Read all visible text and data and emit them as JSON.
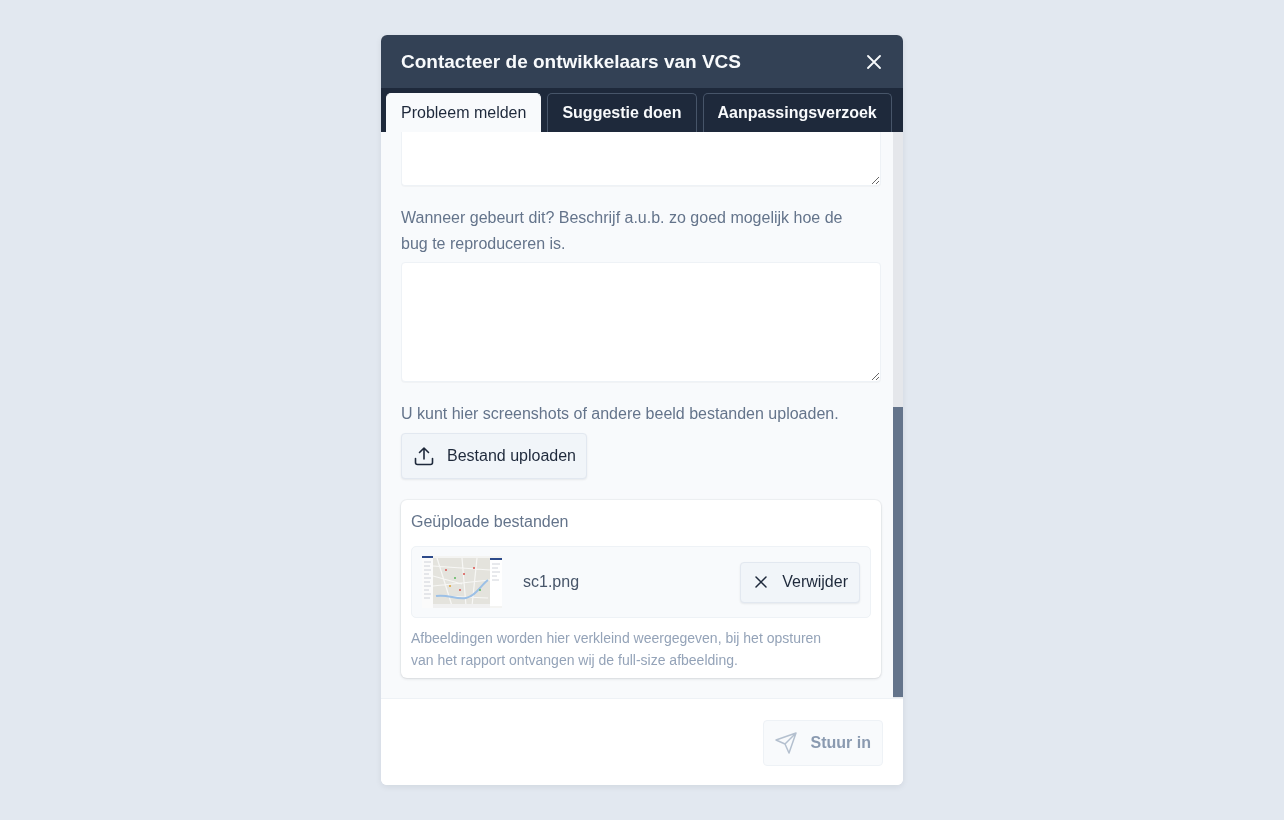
{
  "dialog": {
    "title": "Contacteer de ontwikkelaars van VCS"
  },
  "tabs": [
    {
      "label": "Probleem melden",
      "selected": true
    },
    {
      "label": "Suggestie doen",
      "selected": false
    },
    {
      "label": "Aanpassingsverzoek",
      "selected": false
    }
  ],
  "form": {
    "reproduce_label": "Wanneer gebeurt dit? Beschrijf a.u.b. zo goed mogelijk hoe de bug te reproduceren is.",
    "upload_hint": "U kunt hier screenshots of andere beeld bestanden uploaden.",
    "upload_button": "Bestand uploaden"
  },
  "uploaded_files": {
    "title": "Geüploade bestanden",
    "files": [
      {
        "name": "sc1.png",
        "remove_button": "Verwijder"
      }
    ],
    "note": "Afbeeldingen worden hier verkleind weergegeven, bij het opsturen van het rapport ontvangen wij de full-size afbeelding."
  },
  "footer": {
    "submit_button": {
      "label": "Stuur in",
      "disabled": true
    }
  }
}
